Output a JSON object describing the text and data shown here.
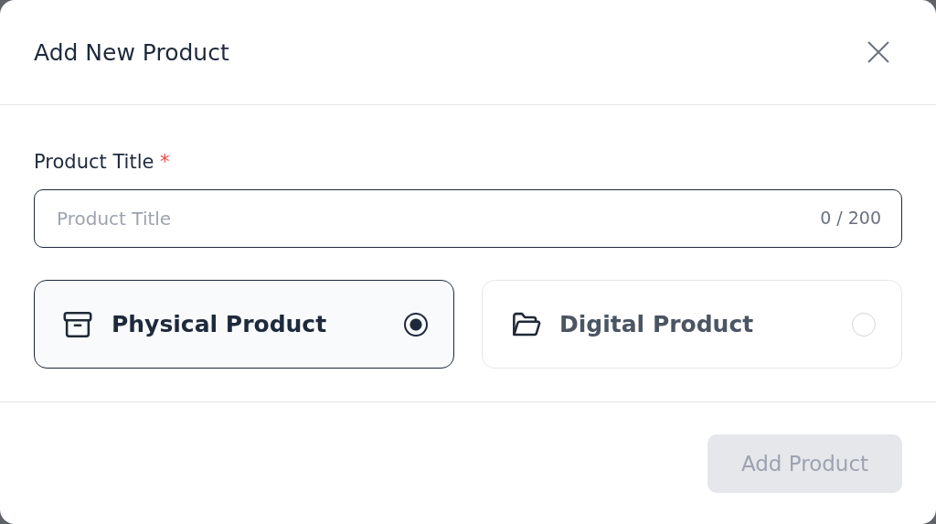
{
  "dialog": {
    "title": "Add New Product"
  },
  "field": {
    "label": "Product Title",
    "required_mark": "*",
    "placeholder": "Product Title",
    "counter": "0 / 200"
  },
  "options": [
    {
      "kind": "box",
      "label": "Physical Product",
      "selected": true
    },
    {
      "kind": "folder",
      "label": "Digital Product",
      "selected": false
    }
  ],
  "submit": {
    "label": "Add Product",
    "disabled": true
  }
}
